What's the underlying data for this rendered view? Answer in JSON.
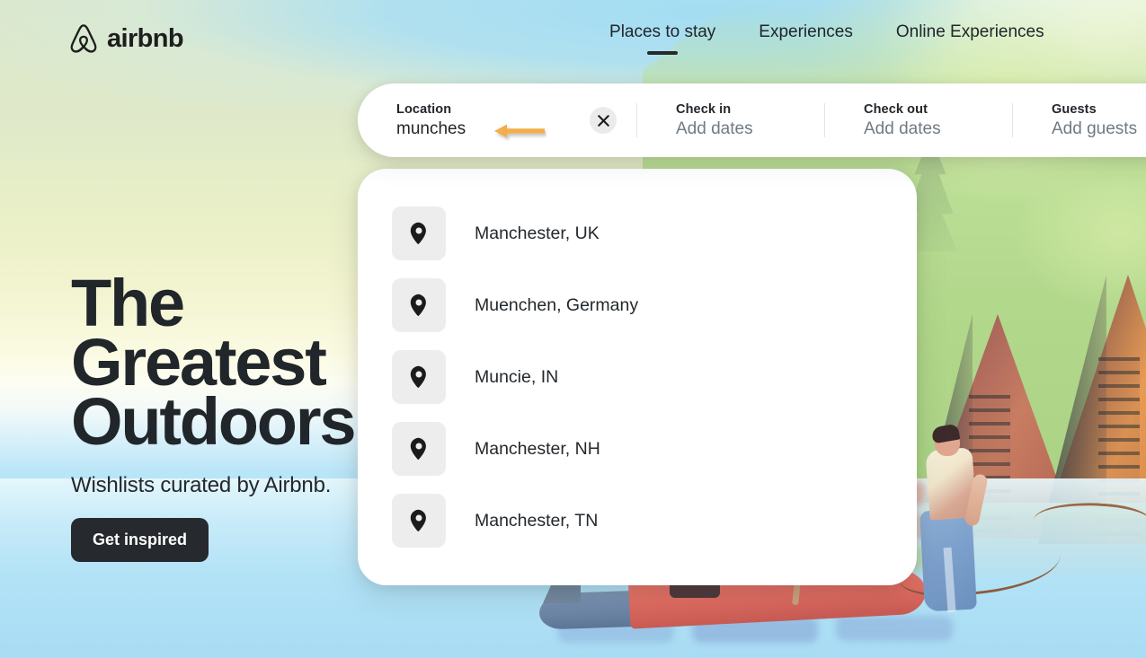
{
  "brand": {
    "name": "airbnb",
    "logo_icon": "airbnb-belo-icon",
    "logo_color": "#1e1e1e"
  },
  "nav": {
    "items": [
      {
        "label": "Places to stay",
        "active": true
      },
      {
        "label": "Experiences",
        "active": false
      },
      {
        "label": "Online Experiences",
        "active": false
      }
    ]
  },
  "search": {
    "location": {
      "label": "Location",
      "value": "munches",
      "clear_icon": "close-icon"
    },
    "check_in": {
      "label": "Check in",
      "value": "Add dates"
    },
    "check_out": {
      "label": "Check out",
      "value": "Add dates"
    },
    "guests": {
      "label": "Guests",
      "value": "Add guests"
    },
    "annotation": {
      "icon": "left-arrow-annotation-icon",
      "color": "#f0a93c"
    }
  },
  "suggestions": {
    "icon": "map-pin-icon",
    "items": [
      {
        "label": "Manchester, UK"
      },
      {
        "label": "Muenchen, Germany"
      },
      {
        "label": "Muncie, IN"
      },
      {
        "label": "Manchester, NH"
      },
      {
        "label": "Manchester, TN"
      }
    ]
  },
  "hero": {
    "title": "The\nGreatest\nOutdoors",
    "subtitle": "Wishlists curated by Airbnb.",
    "cta_label": "Get inspired",
    "cta_bg": "#26292d"
  },
  "theme": {
    "page_bg_top": "#dde8cc",
    "sky_blue": "#aee1f6",
    "cream": "#fbfbe4",
    "hill_green": "#b6de94",
    "cabin_orange": "#e79b52",
    "cabin_rust": "#c87d62",
    "canoe_red": "#dd6a60",
    "text_dark": "#21262b",
    "text_muted": "#717a82"
  }
}
